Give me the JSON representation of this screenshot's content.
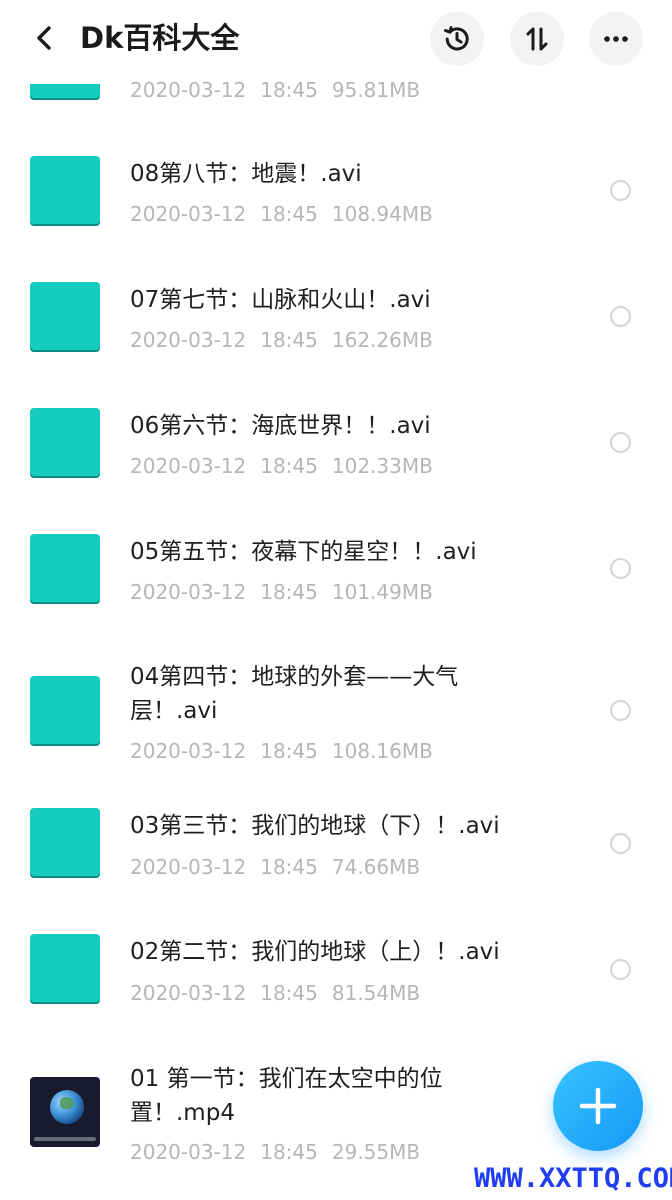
{
  "header": {
    "title": "Dk百科大全"
  },
  "files": [
    {
      "name": "",
      "date": "2020-03-12",
      "time": "18:45",
      "size": "95.81MB",
      "thumb": "teal",
      "partial": true
    },
    {
      "name": "08第八节：地震！.avi",
      "date": "2020-03-12",
      "time": "18:45",
      "size": "108.94MB",
      "thumb": "teal"
    },
    {
      "name": "07第七节：山脉和火山！.avi",
      "date": "2020-03-12",
      "time": "18:45",
      "size": "162.26MB",
      "thumb": "teal"
    },
    {
      "name": "06第六节：海底世界！！.avi",
      "date": "2020-03-12",
      "time": "18:45",
      "size": "102.33MB",
      "thumb": "teal"
    },
    {
      "name": "05第五节：夜幕下的星空！！.avi",
      "date": "2020-03-12",
      "time": "18:45",
      "size": "101.49MB",
      "thumb": "teal"
    },
    {
      "name": "04第四节：地球的外套——大气层！.avi",
      "date": "2020-03-12",
      "time": "18:45",
      "size": "108.16MB",
      "thumb": "teal"
    },
    {
      "name": "03第三节：我们的地球（下）！.avi",
      "date": "2020-03-12",
      "time": "18:45",
      "size": "74.66MB",
      "thumb": "teal"
    },
    {
      "name": "02第二节：我们的地球（上）！.avi",
      "date": "2020-03-12",
      "time": "18:45",
      "size": "81.54MB",
      "thumb": "teal"
    },
    {
      "name": "01 第一节：我们在太空中的位置！.mp4",
      "date": "2020-03-12",
      "time": "18:45",
      "size": "29.55MB",
      "thumb": "earth-image"
    }
  ],
  "watermark": "WWW.XXTTQ.COM",
  "icons": {
    "back": "chevron-left-icon",
    "history": "history-icon",
    "sort": "sort-icon",
    "more": "more-icon",
    "add": "plus-icon"
  },
  "colors": {
    "thumb": "#14cdbe",
    "fab": "#1698f5",
    "meta": "#b4b6ba",
    "watermark": "#1f3df2"
  }
}
